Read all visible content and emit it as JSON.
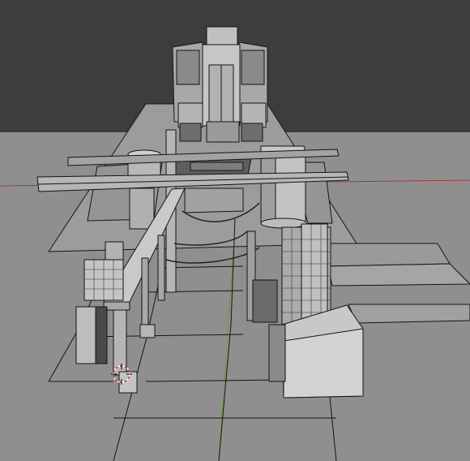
{
  "viewport": {
    "label": "3D Viewport",
    "view": "perspective",
    "shading": "solid",
    "colors": {
      "background": "#3d3d3d",
      "floor": "#8f8f8f",
      "mesh_light": "#c4c4c4",
      "mesh_mid": "#a9a9a9",
      "mesh_dark": "#7a7a7a",
      "edge": "#141414",
      "axis_x": "#a33a3a",
      "axis_y": "#6f9a3a"
    }
  },
  "scene": {
    "description_visible_text": "",
    "objects": [
      "factory-tower",
      "conveyor-track",
      "left-pedestal",
      "right-pedestal",
      "crossbeams",
      "walkway-beam",
      "left-control-box",
      "right-battery-stack",
      "right-base-block",
      "right-platforms"
    ]
  },
  "cursor": {
    "icon": "3d-cursor-icon"
  }
}
